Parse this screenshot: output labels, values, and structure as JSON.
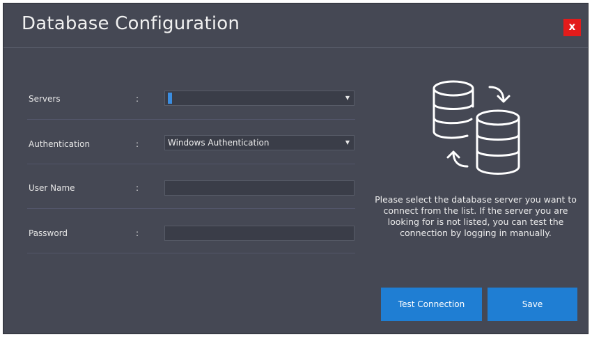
{
  "window": {
    "title": "Database Configuration",
    "close_label": "x"
  },
  "form": {
    "rows": [
      {
        "label": "Servers",
        "colon": ":",
        "value": "",
        "type": "dropdown"
      },
      {
        "label": "Authentication",
        "colon": ":",
        "value": "Windows Authentication",
        "type": "dropdown"
      },
      {
        "label": "User Name",
        "colon": ":",
        "value": "",
        "type": "text"
      },
      {
        "label": "Password",
        "colon": ":",
        "value": "",
        "type": "password"
      }
    ]
  },
  "info": {
    "icon": "database-sync-icon",
    "text": "Please select the database server you want to connect from the list. If the server you are looking for is not listed, you can test the connection by logging in manually."
  },
  "buttons": {
    "test_connection": "Test Connection",
    "save": "Save"
  },
  "colors": {
    "background": "#454854",
    "accent": "#1f7ed3",
    "close": "#e31b1b"
  }
}
